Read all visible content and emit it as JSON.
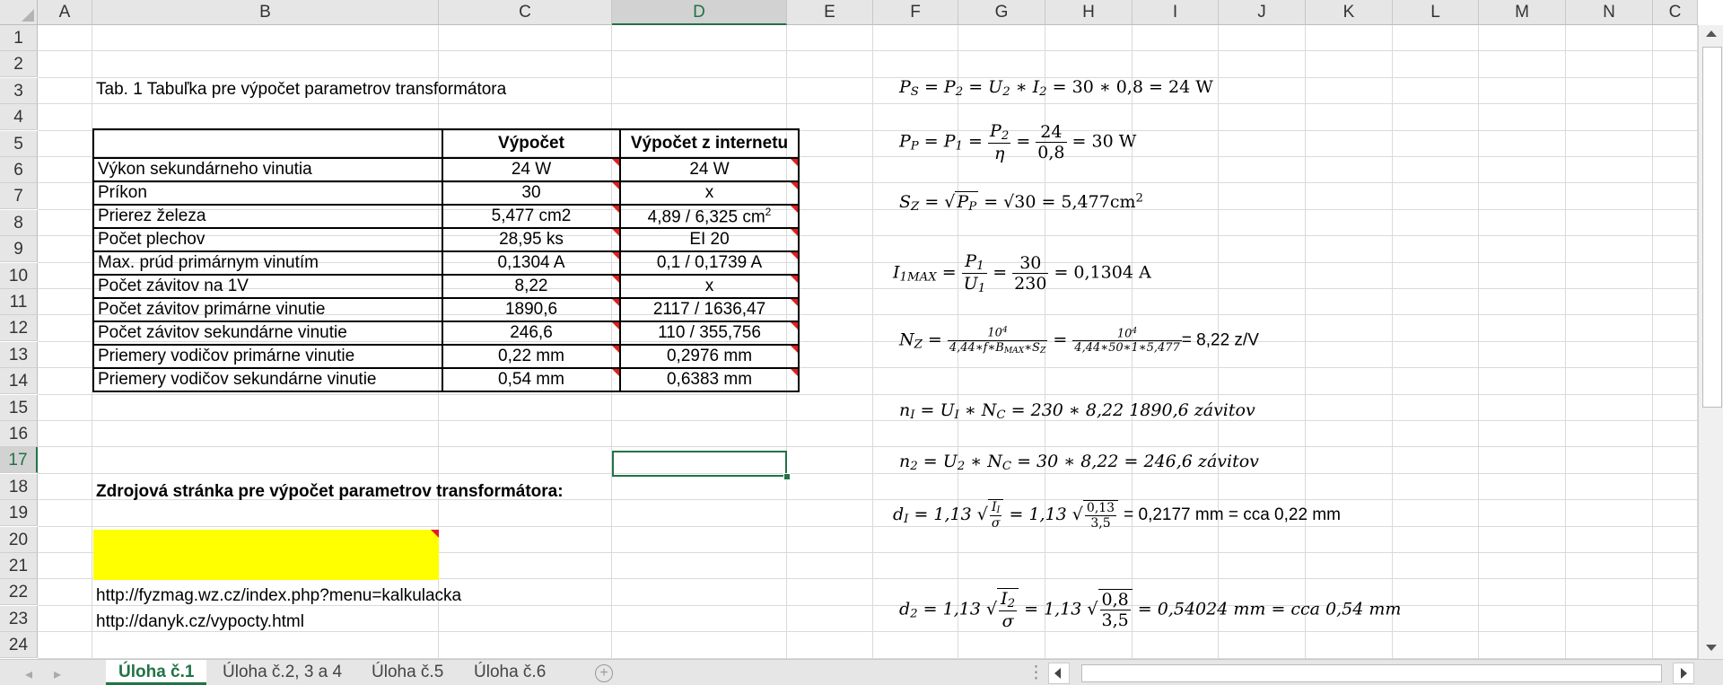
{
  "columns": [
    "A",
    "B",
    "C",
    "D",
    "E",
    "F",
    "G",
    "H",
    "I",
    "J",
    "K",
    "L",
    "M",
    "N",
    "C"
  ],
  "rows": [
    "1",
    "2",
    "3",
    "4",
    "5",
    "6",
    "7",
    "8",
    "9",
    "10",
    "11",
    "12",
    "13",
    "14",
    "15",
    "16",
    "17",
    "18",
    "19",
    "20",
    "21",
    "22",
    "23",
    "24"
  ],
  "table_title": "Tab. 1 Tabuľka pre výpočet parametrov transformátora",
  "table": {
    "headers": [
      "",
      "Výpočet",
      "Výpočet z internetu"
    ],
    "rows": [
      [
        "Výkon sekundárneho vinutia",
        "24 W",
        "24 W"
      ],
      [
        "Príkon",
        "30",
        "x"
      ],
      [
        "Prierez železa",
        "5,477 cm2",
        "4,89 / 6,325 cm"
      ],
      [
        "Počet plechov",
        "28,95 ks",
        "EI 20"
      ],
      [
        "Max. prúd primárnym vinutím",
        "0,1304 A",
        "0,1 / 0,1739 A"
      ],
      [
        "Počet závitov na 1V",
        "8,22",
        "x"
      ],
      [
        "Počet závitov primárne vinutie",
        "1890,6",
        "2117 / 1636,47"
      ],
      [
        "Počet závitov  sekundárne vinutie",
        "246,6",
        "110 / 355,756"
      ],
      [
        "Priemery vodičov  primárne vinutie",
        "0,22 mm",
        "0,2976 mm"
      ],
      [
        "Priemery vodičov  sekundárne vinutie",
        "0,54 mm",
        "0,6383 mm"
      ]
    ],
    "sup_text": "2"
  },
  "source_heading": "Zdrojová stránka pre výpočet parametrov transformátora:",
  "links": [
    "http://fyzmag.wz.cz/index.php?menu=kalkulacka",
    "http://danyk.cz/vypocty.html"
  ],
  "formulas": {
    "ps": "= 30 ∗ 0,8 = 24 W",
    "pp_result": "= 30 W",
    "pp_num": "24",
    "pp_den": "0,8",
    "sz": "= √30 = 5,477cm",
    "i_num": "30",
    "i_den": "230",
    "i_result": "= 0,1304 A",
    "n_result": "= 8,22 z/V",
    "n_i": "= 230 ∗ 8,22 1890,6 závitov",
    "n_2": "= 30 ∗ 8,22 = 246,6 závitov",
    "d_i": "= 0,2177 mm = cca 0,22 mm",
    "d_2": "= 0,54024 mm = cca 0,54 mm"
  },
  "sheet_tabs": [
    "Úloha č.1",
    "Úloha č.2, 3 a 4",
    "Úloha č.5",
    "Úloha č.6"
  ],
  "accent_color": "#217346",
  "highlight_color": "#ffff00"
}
